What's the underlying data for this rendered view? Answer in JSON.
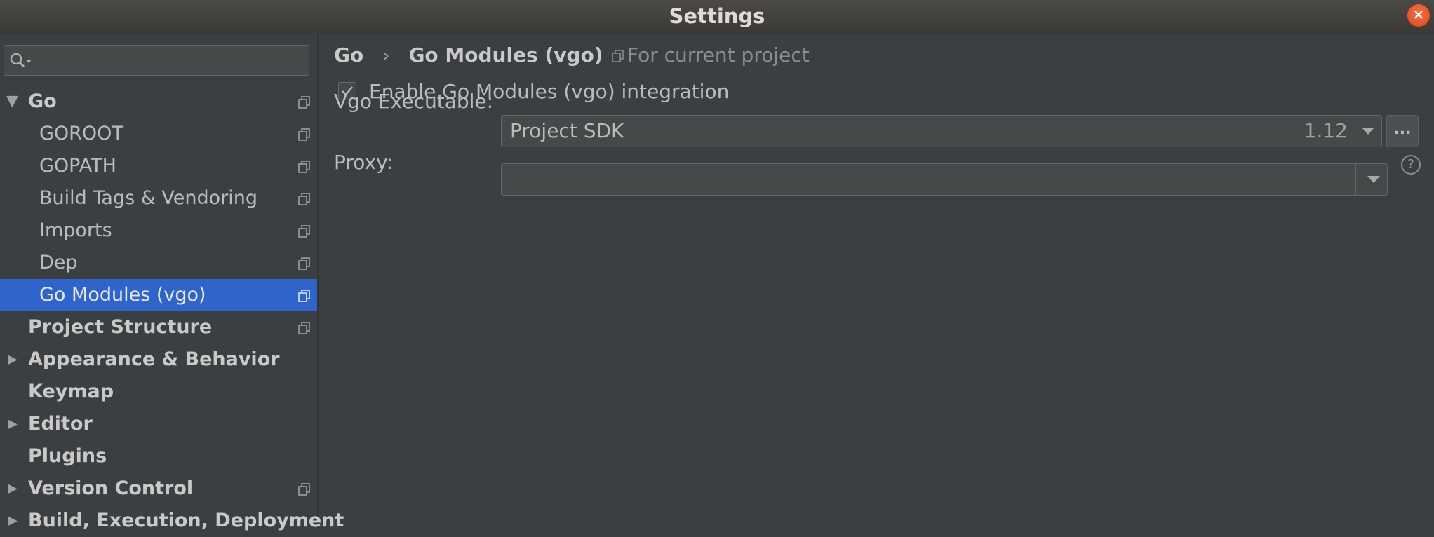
{
  "window": {
    "title": "Settings"
  },
  "search": {
    "placeholder": ""
  },
  "tree": [
    {
      "label": "Go",
      "bold": true,
      "expanded": true,
      "indent": 0,
      "copy": true
    },
    {
      "label": "GOROOT",
      "bold": false,
      "indent": 1,
      "copy": true
    },
    {
      "label": "GOPATH",
      "bold": false,
      "indent": 1,
      "copy": true
    },
    {
      "label": "Build Tags & Vendoring",
      "bold": false,
      "indent": 1,
      "copy": true
    },
    {
      "label": "Imports",
      "bold": false,
      "indent": 1,
      "copy": true
    },
    {
      "label": "Dep",
      "bold": false,
      "indent": 1,
      "copy": true
    },
    {
      "label": "Go Modules (vgo)",
      "bold": false,
      "indent": 1,
      "copy": true,
      "selected": true
    },
    {
      "label": "Project Structure",
      "bold": true,
      "indent": 0,
      "copy": true
    },
    {
      "label": "Appearance & Behavior",
      "bold": true,
      "indent": 0,
      "collapsed": true
    },
    {
      "label": "Keymap",
      "bold": true,
      "indent": 0
    },
    {
      "label": "Editor",
      "bold": true,
      "indent": 0,
      "collapsed": true
    },
    {
      "label": "Plugins",
      "bold": true,
      "indent": 0
    },
    {
      "label": "Version Control",
      "bold": true,
      "indent": 0,
      "collapsed": true,
      "copy": true
    },
    {
      "label": "Build, Execution, Deployment",
      "bold": true,
      "indent": 0,
      "collapsed": true
    }
  ],
  "breadcrumb": {
    "parent": "Go",
    "separator": "›",
    "current": "Go Modules (vgo)"
  },
  "scope": {
    "label": "For current project"
  },
  "settings": {
    "enable_label": "Enable Go Modules (vgo) integration",
    "enable_checked": true,
    "vgo_label": "Vgo Executable:",
    "vgo_value": "Project SDK",
    "vgo_version": "1.12",
    "browse_label": "...",
    "proxy_label": "Proxy:",
    "proxy_value": "",
    "help_label": "?"
  },
  "colors": {
    "selection": "#2f65ca",
    "background": "#3c3f41",
    "close": "#e05a2e"
  }
}
